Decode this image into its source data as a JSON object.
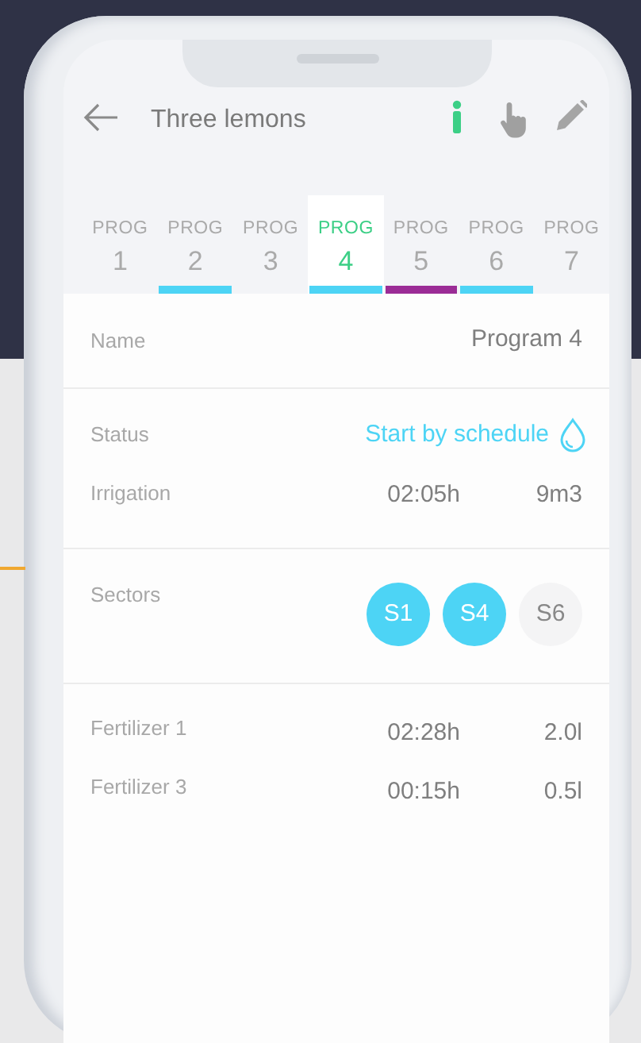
{
  "header": {
    "title": "Three lemons"
  },
  "tabs": [
    {
      "label": "PROG",
      "number": "1",
      "selected": false
    },
    {
      "label": "PROG",
      "number": "2",
      "selected": false,
      "color": "#4dd4f5"
    },
    {
      "label": "PROG",
      "number": "3",
      "selected": false
    },
    {
      "label": "PROG",
      "number": "4",
      "selected": true,
      "color": "#4dd4f5"
    },
    {
      "label": "PROG",
      "number": "5",
      "selected": false,
      "color": "#9b2c96"
    },
    {
      "label": "PROG",
      "number": "6",
      "selected": false,
      "color": "#4dd4f5"
    },
    {
      "label": "PROG",
      "number": "7",
      "selected": false
    }
  ],
  "details": {
    "name_label": "Name",
    "name_value": "Program 4",
    "status_label": "Status",
    "status_value": "Start by schedule",
    "irrigation_label": "Irrigation",
    "irrigation_time": "02:05h",
    "irrigation_volume": "9m3",
    "sectors_label": "Sectors",
    "sectors": [
      {
        "label": "S1",
        "active": true
      },
      {
        "label": "S4",
        "active": true
      },
      {
        "label": "S6",
        "active": false
      }
    ],
    "fertilizers": [
      {
        "name": "Fertilizer 1",
        "time": "02:28h",
        "volume": "2.0l"
      },
      {
        "name": "Fertilizer 3",
        "time": "00:15h",
        "volume": "0.5l"
      }
    ]
  }
}
